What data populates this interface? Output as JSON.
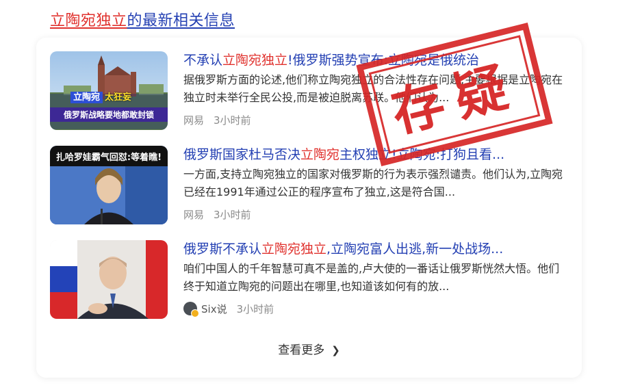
{
  "header": {
    "title_highlight": "立陶宛独立",
    "title_rest": "的最新相关信息"
  },
  "items": [
    {
      "headline_pre": "不承认",
      "headline_hl": "立陶宛独立",
      "headline_post": "!俄罗斯强势宣布:立陶宛是俄统治",
      "snippet": "据俄罗斯方面的论述,他们称立陶宛独立的合法性存在问题,主要根据是立陶宛在独立时未举行全民公投,而是被迫脱离苏联。他们认为...",
      "source": "网易",
      "time": "3小时前",
      "thumb_text_1": "立陶宛",
      "thumb_text_1b": "太狂妄",
      "thumb_text_2": "俄罗斯战略要地都敢封锁"
    },
    {
      "headline_pre": "俄罗斯国家杜马否决",
      "headline_hl": "立陶宛",
      "headline_post": "主权独立!立陶宛:打狗且看...",
      "snippet": "一方面,支持立陶宛独立的国家对俄罗斯的行为表示强烈谴责。他们认为,立陶宛已经在1991年通过公正的程序宣布了独立,这是符合国...",
      "source": "网易",
      "time": "3小时前",
      "thumb_text_1": "扎哈罗娃霸气回怼:等着瞧!"
    },
    {
      "headline_pre": "俄罗斯不承认",
      "headline_hl": "立陶宛独立",
      "headline_post": ",立陶宛富人出逃,新一处战场...",
      "snippet": "咱们中国人的千年智慧可真不是盖的,卢大使的一番话让俄罗斯恍然大悟。他们终于知道立陶宛的问题出在哪里,也知道该如何有的放...",
      "source": "Six说",
      "time": "3小时前"
    }
  ],
  "more_label": "查看更多",
  "stamp_text": "存疑",
  "colors": {
    "link": "#2440b3",
    "highlight": "#e0312d",
    "stamp": "#d62626"
  }
}
